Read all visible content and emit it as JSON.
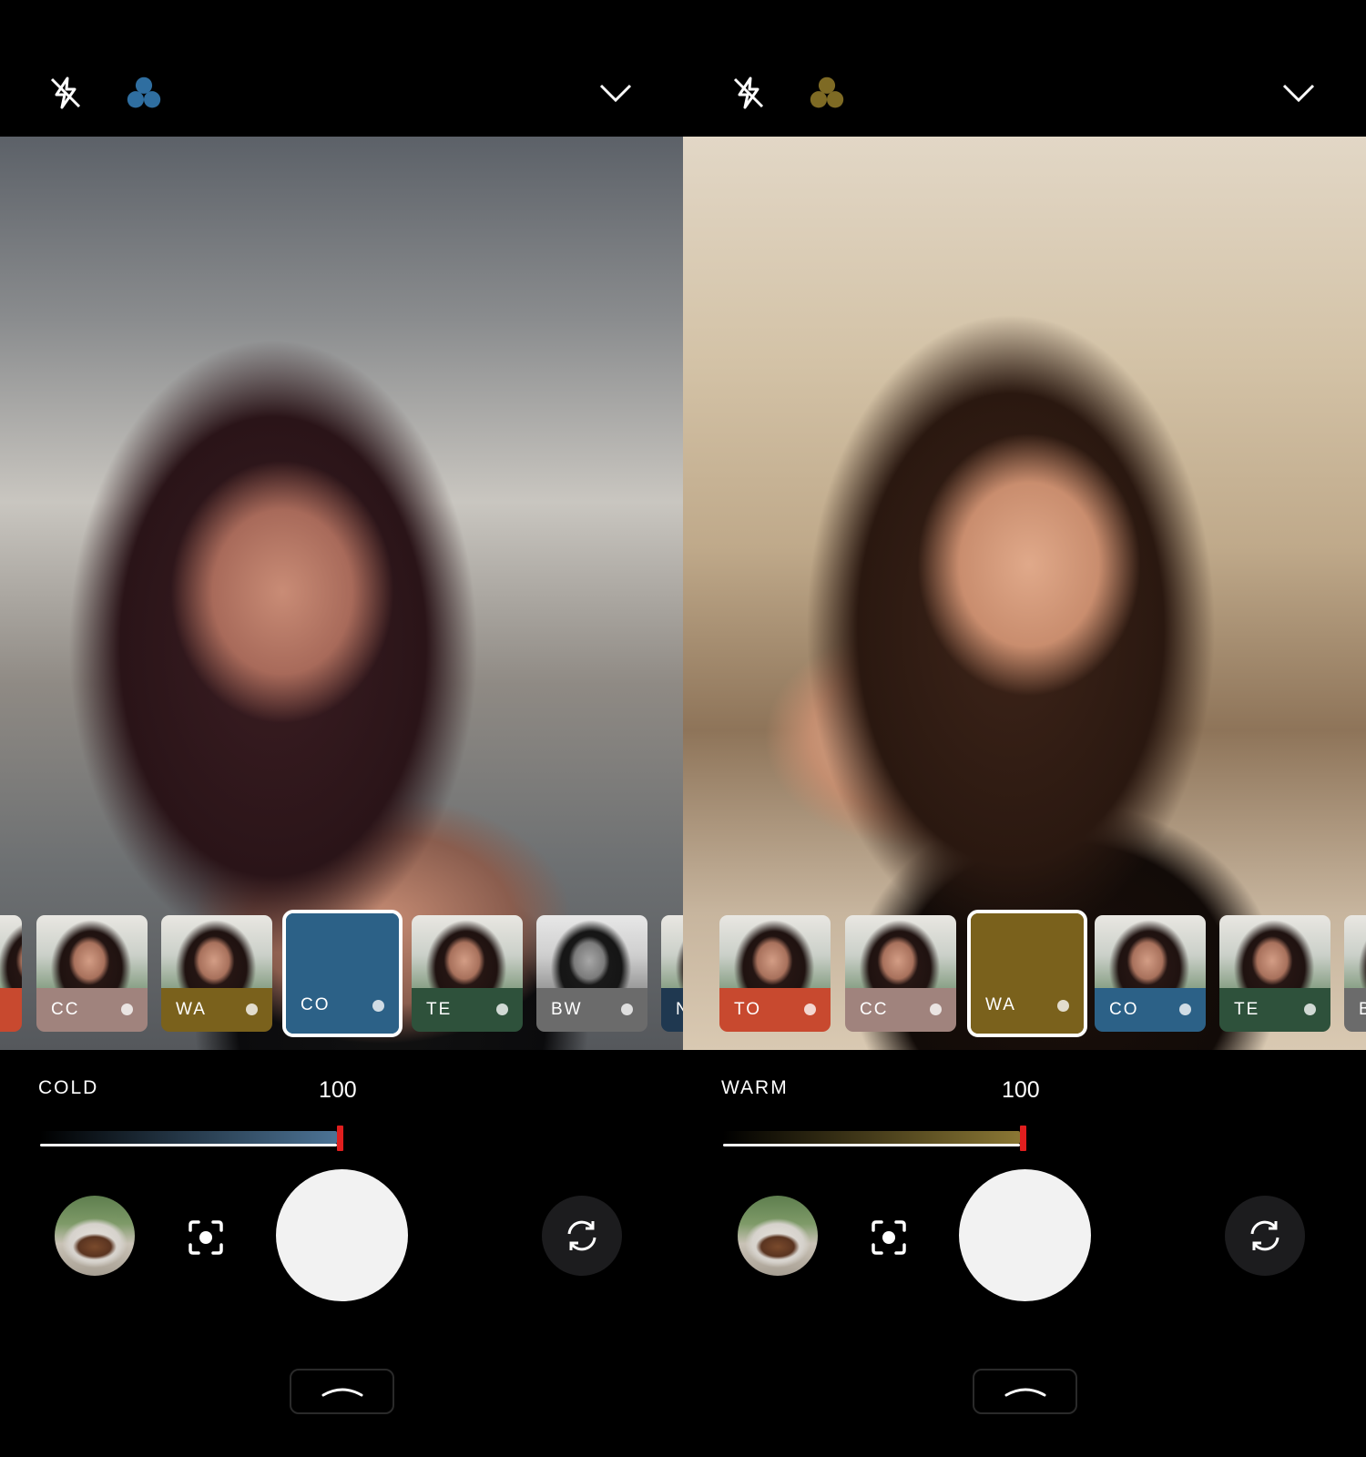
{
  "panels": [
    {
      "id": "left",
      "filter_icon_color": "#2f6ea0",
      "filter_strip": [
        {
          "label": "",
          "color": "#c8492f",
          "partial": true
        },
        {
          "label": "CC",
          "color": "#a0837d"
        },
        {
          "label": "WA",
          "color": "#7a611c"
        },
        {
          "label": "CO",
          "color": "#2c6187",
          "selected": true
        },
        {
          "label": "TE",
          "color": "#2e513b"
        },
        {
          "label": "BW",
          "color": "#6b6b6b",
          "bw": true
        },
        {
          "label": "N",
          "color": "#1f3850",
          "partial": true
        }
      ],
      "filter_name": "COLD",
      "intensity_value": "100",
      "intensity": 1.0,
      "track_color": "#4c7395"
    },
    {
      "id": "right",
      "filter_icon_color": "#7e6a24",
      "filter_strip": [
        {
          "label": "TO",
          "color": "#c8492f"
        },
        {
          "label": "CC",
          "color": "#a0837d"
        },
        {
          "label": "WA",
          "color": "#7a611c",
          "selected": true
        },
        {
          "label": "CO",
          "color": "#2c6187"
        },
        {
          "label": "TE",
          "color": "#2e513b"
        },
        {
          "label": "B",
          "color": "#6b6b6b",
          "partial": true
        }
      ],
      "filter_name": "WARM",
      "intensity_value": "100",
      "intensity": 1.0,
      "track_color": "#8a7734"
    }
  ]
}
